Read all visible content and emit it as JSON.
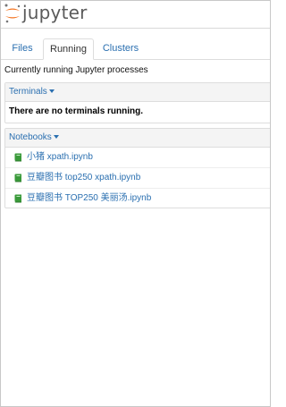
{
  "header": {
    "brand": "jupyter",
    "logo_icon": "jupyter-logo-icon"
  },
  "tabs": [
    {
      "label": "Files",
      "active": false
    },
    {
      "label": "Running",
      "active": true
    },
    {
      "label": "Clusters",
      "active": false
    }
  ],
  "running_note": "Currently running Jupyter processes",
  "terminals": {
    "title": "Terminals",
    "empty_message": "There are no terminals running."
  },
  "notebooks": {
    "title": "Notebooks",
    "items": [
      {
        "name": "小猪 xpath.ipynb",
        "icon": "notebook-icon"
      },
      {
        "name": "豆瓣图书 top250 xpath.ipynb",
        "icon": "notebook-icon"
      },
      {
        "name": "豆瓣图书 TOP250 美丽汤.ipynb",
        "icon": "notebook-icon"
      }
    ]
  },
  "colors": {
    "link": "#2a6fb0",
    "notebook_icon": "#3a9a3a",
    "logo_orange": "#f37726"
  }
}
